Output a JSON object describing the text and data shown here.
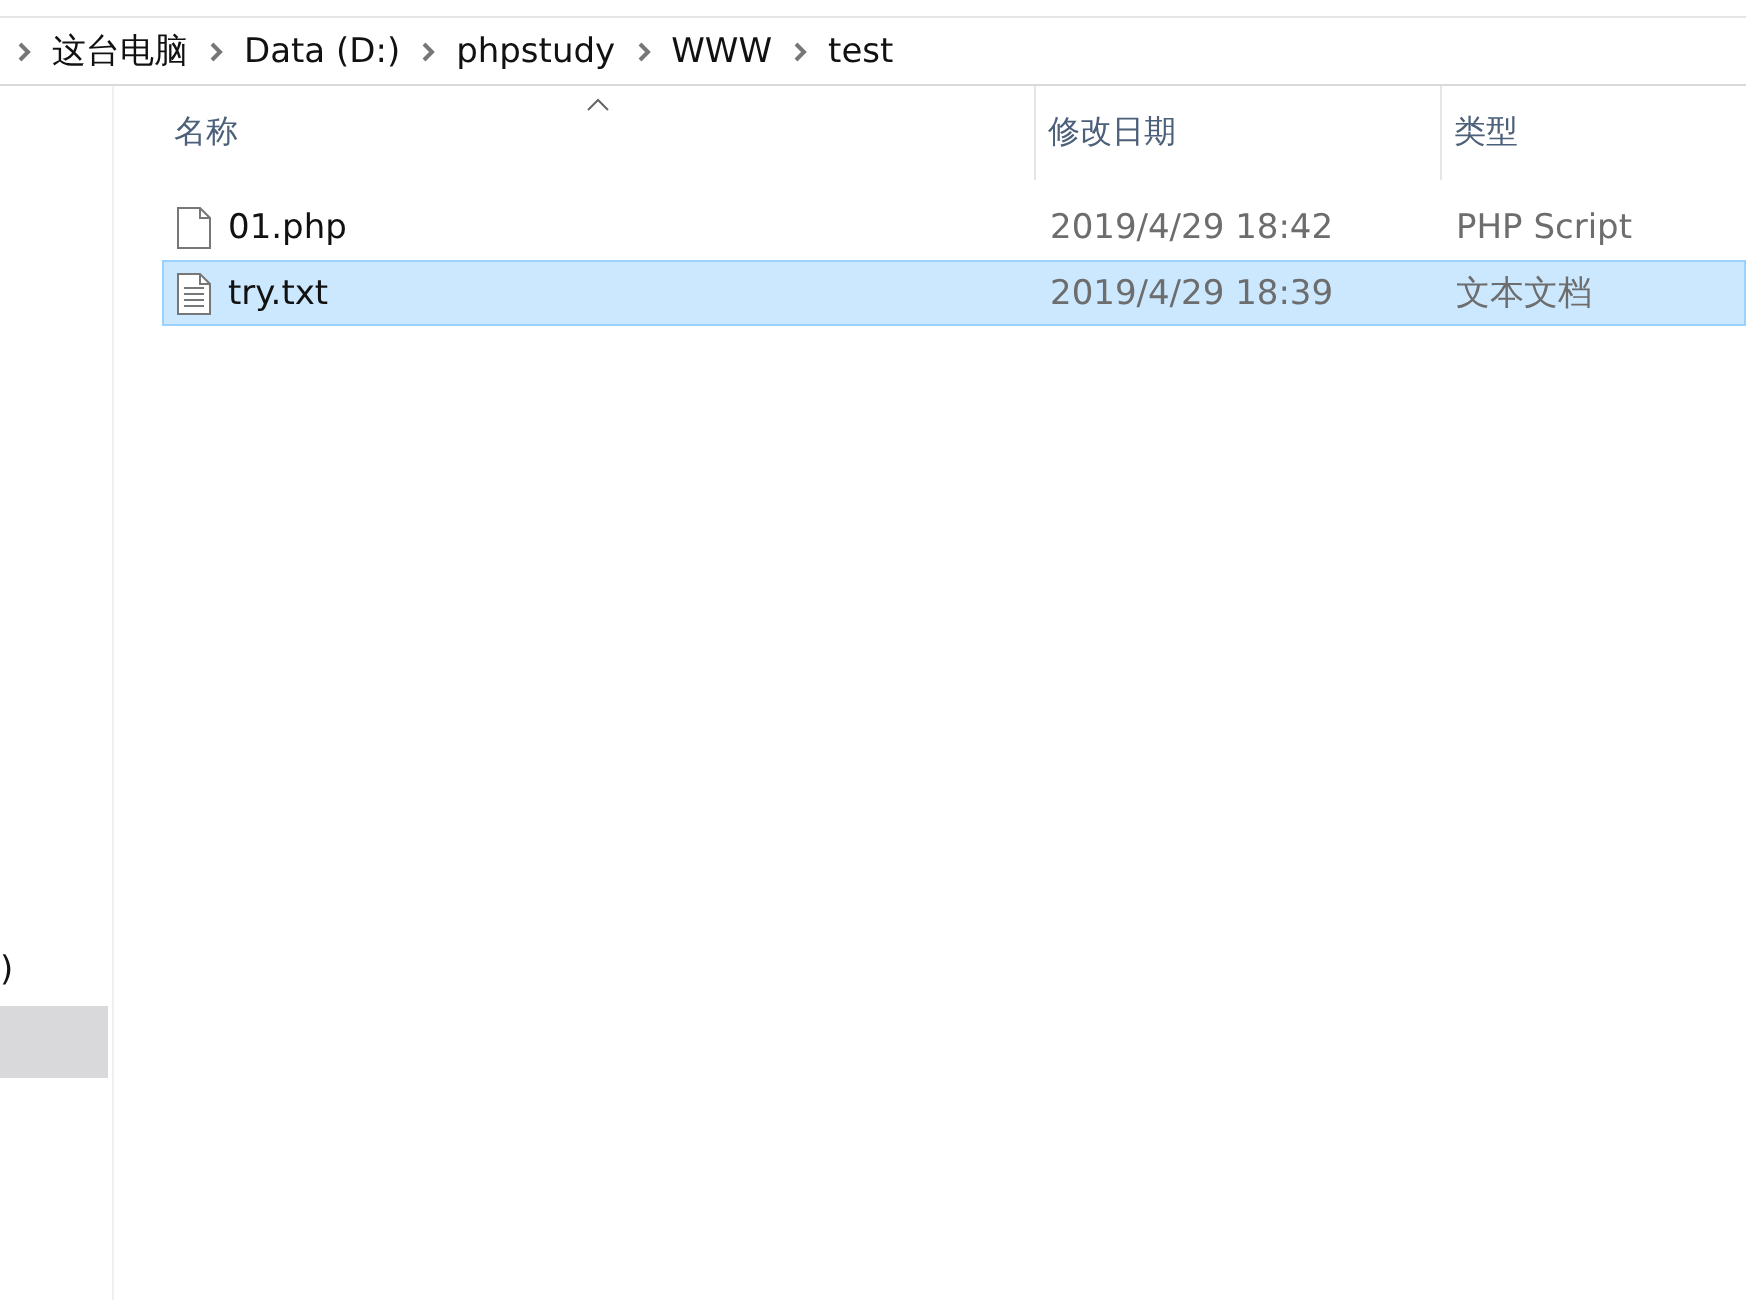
{
  "address_bar": {
    "path": [
      {
        "label": "这台电脑"
      },
      {
        "label": "Data (D:)"
      },
      {
        "label": "phpstudy"
      },
      {
        "label": "WWW"
      },
      {
        "label": "test"
      }
    ]
  },
  "navigation_pane": {
    "items": [
      {
        "label": ")",
        "selected": false
      },
      {
        "selected": true
      }
    ]
  },
  "file_list": {
    "columns": [
      {
        "label": "名称",
        "sorted": true
      },
      {
        "label": "修改日期",
        "sorted": false
      },
      {
        "label": "类型",
        "sorted": false
      }
    ],
    "rows": [
      {
        "kind": "php",
        "name": "01.php",
        "modified": "2019/4/29 18:42",
        "type": "PHP Script",
        "selected": false
      },
      {
        "kind": "txt",
        "name": "try.txt",
        "modified": "2019/4/29 18:39",
        "type": "文本文档",
        "selected": true
      }
    ]
  }
}
